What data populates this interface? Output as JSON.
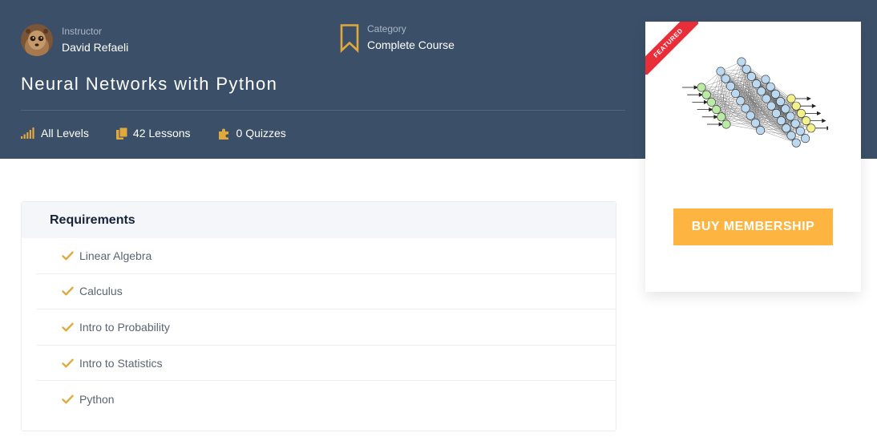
{
  "instructor": {
    "label": "Instructor",
    "name": "David Refaeli"
  },
  "category": {
    "label": "Category",
    "value": "Complete Course"
  },
  "course": {
    "title": "Neural Networks with Python"
  },
  "stats": {
    "level": "All Levels",
    "lessons": "42 Lessons",
    "quizzes": "0 Quizzes"
  },
  "sidebar": {
    "ribbon_label": "FEATURED",
    "buy_label": "BUY MEMBERSHIP"
  },
  "requirements": {
    "title": "Requirements",
    "items": [
      {
        "text": "Linear Algebra"
      },
      {
        "text": "Calculus"
      },
      {
        "text": "Intro to Probability"
      },
      {
        "text": "Intro to Statistics"
      },
      {
        "text": "Python"
      }
    ]
  },
  "colors": {
    "hero_bg": "#3b5068",
    "accent": "#e1a93c",
    "button": "#fdb441",
    "ribbon": "#ea2e39"
  },
  "icons": {
    "level": "signal-bars-icon",
    "lessons": "documents-icon",
    "quizzes": "puzzle-icon",
    "category": "bookmark-icon",
    "requirement": "check-icon"
  }
}
